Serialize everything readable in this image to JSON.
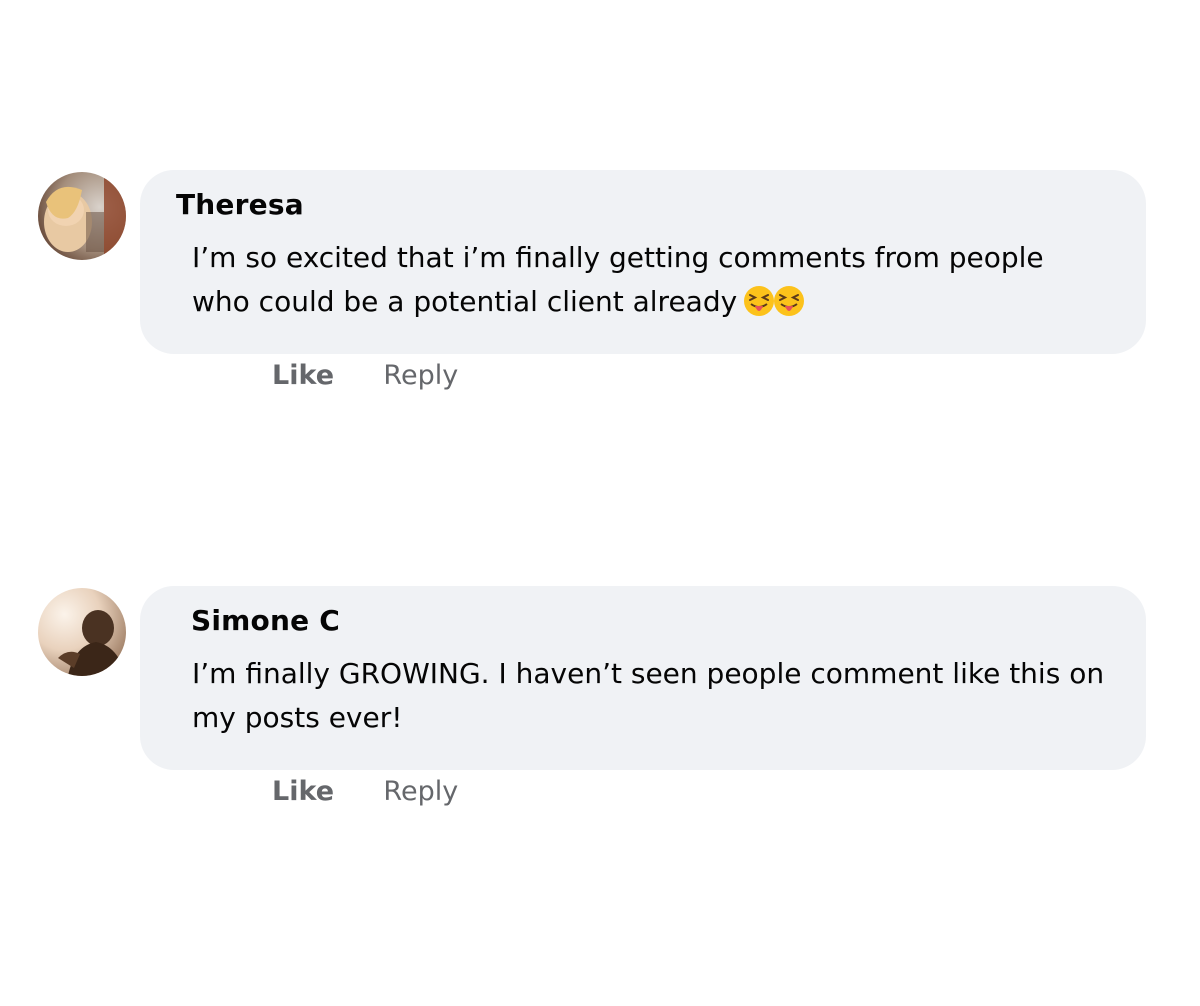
{
  "comments": [
    {
      "author": "Theresa",
      "lines": [
        "I’m so excited that i’m finally getting comments from people",
        "who could be a potential client already"
      ],
      "emoji": [
        "squinting-face-with-tongue",
        "squinting-face-with-tongue"
      ],
      "actions": {
        "like": "Like",
        "reply": "Reply"
      }
    },
    {
      "author": "Simone C",
      "lines": [
        "I’m finally GROWING. I haven’t seen people comment like this on",
        "my posts ever!"
      ],
      "emoji": [],
      "actions": {
        "like": "Like",
        "reply": "Reply"
      }
    }
  ],
  "colors": {
    "bubble": "#f0f2f5",
    "action_text": "#65676b",
    "text": "#050505"
  }
}
